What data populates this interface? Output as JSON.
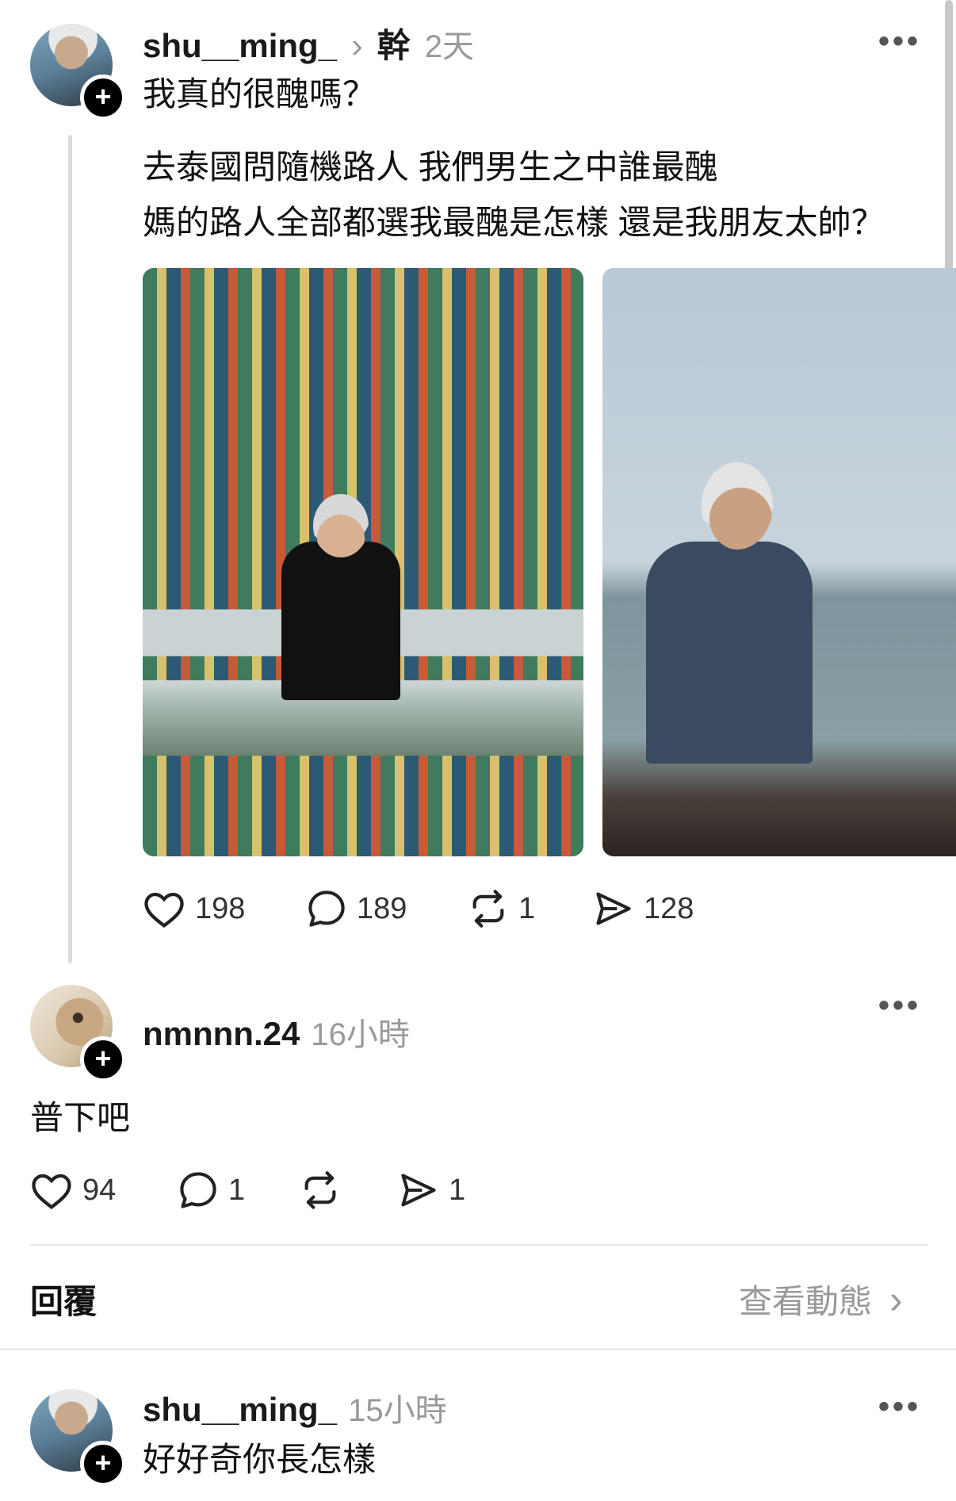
{
  "post": {
    "username": "shu__ming_",
    "separator": "›",
    "topic": "幹",
    "time": "2天",
    "title": "我真的很醜嗎？",
    "body_lines": [
      "去泰國問隨機路人 我們男生之中誰最醜",
      "媽的路人全部都選我最醜是怎樣 還是我朋友太帥？"
    ],
    "photos": [
      "temple-photo",
      "seaside-photo"
    ],
    "likes": "198",
    "comments": "189",
    "reposts": "1",
    "shares": "128",
    "more_label": "•••"
  },
  "reply1": {
    "username": "nmnnn.24",
    "time": "16小時",
    "text": "普下吧",
    "likes": "94",
    "comments": "1",
    "reposts": "",
    "shares": "1",
    "more_label": "•••"
  },
  "reply_bar": {
    "label": "回覆",
    "view_activity": "查看動態",
    "chevron": "›"
  },
  "reply2": {
    "username": "shu__ming_",
    "time": "15小時",
    "text": "好好奇你長怎樣",
    "more_label": "•••"
  },
  "icons": {
    "heart": "heart-icon",
    "comment": "comment-icon",
    "repost": "repost-icon",
    "share": "send-icon",
    "follow": "plus-icon"
  }
}
